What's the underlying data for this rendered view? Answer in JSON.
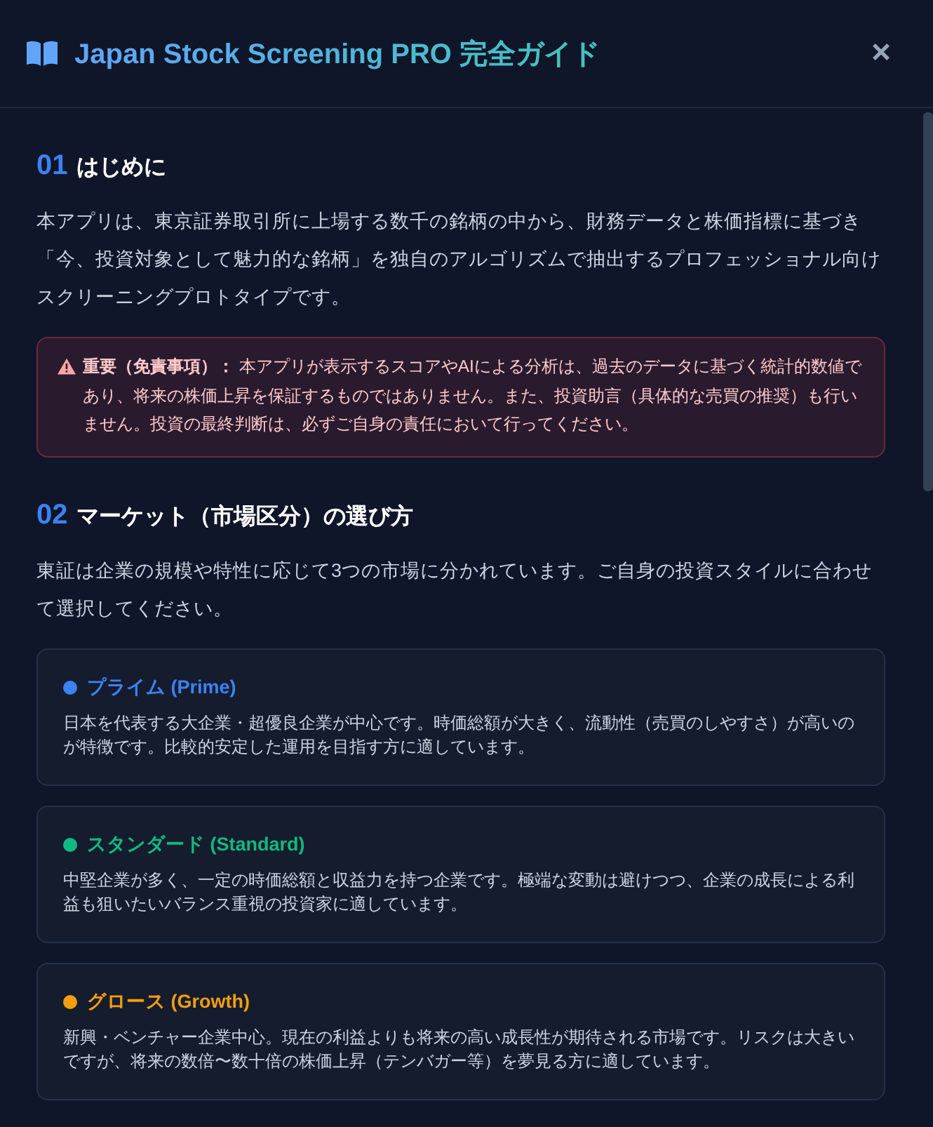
{
  "dialog": {
    "title": "Japan Stock Screening PRO 完全ガイド",
    "close": "×"
  },
  "sections": [
    {
      "number": "01",
      "heading": "はじめに",
      "body": "本アプリは、東京証券取引所に上場する数千の銘柄の中から、財務データと株価指標に基づき「今、投資対象として魅力的な銘柄」を独自のアルゴリズムで抽出するプロフェッショナル向けスクリーニングプロトタイプです。",
      "warning": "**重要（免責事項）：** 本アプリが表示するスコアやAIによる分析は、過去のデータに基づく統計的数値であり、将来の株価上昇を保証するものではありません。また、投資助言（具体的な売買の推奨）も行いません。投資の最終判断は、必ずご自身の責任において行ってください。"
    },
    {
      "number": "02",
      "heading": "マーケット（市場区分）の選び方",
      "body": "東証は企業の規模や特性に応じて3つの市場に分かれています。ご自身の投資スタイルに合わせて選択してください。",
      "markets": [
        {
          "name": "プライム (Prime)",
          "color": "#3b82f6",
          "description": "日本を代表する大企業・超優良企業が中心です。時価総額が大きく、流動性（売買のしやすさ）が高いのが特徴です。比較的安定した運用を目指す方に適しています。"
        },
        {
          "name": "スタンダード (Standard)",
          "color": "#10b981",
          "description": "中堅企業が多く、一定の時価総額と収益力を持つ企業です。極端な変動は避けつつ、企業の成長による利益も狙いたいバランス重視の投資家に適しています。"
        },
        {
          "name": "グロース (Growth)",
          "color": "#f59e0b",
          "description": "新興・ベンチャー企業中心。現在の利益よりも将来の高い成長性が期待される市場です。リスクは大きいですが、将来の数倍〜数十倍の株価上昇（テンバガー等）を夢見る方に適しています。"
        }
      ]
    }
  ]
}
